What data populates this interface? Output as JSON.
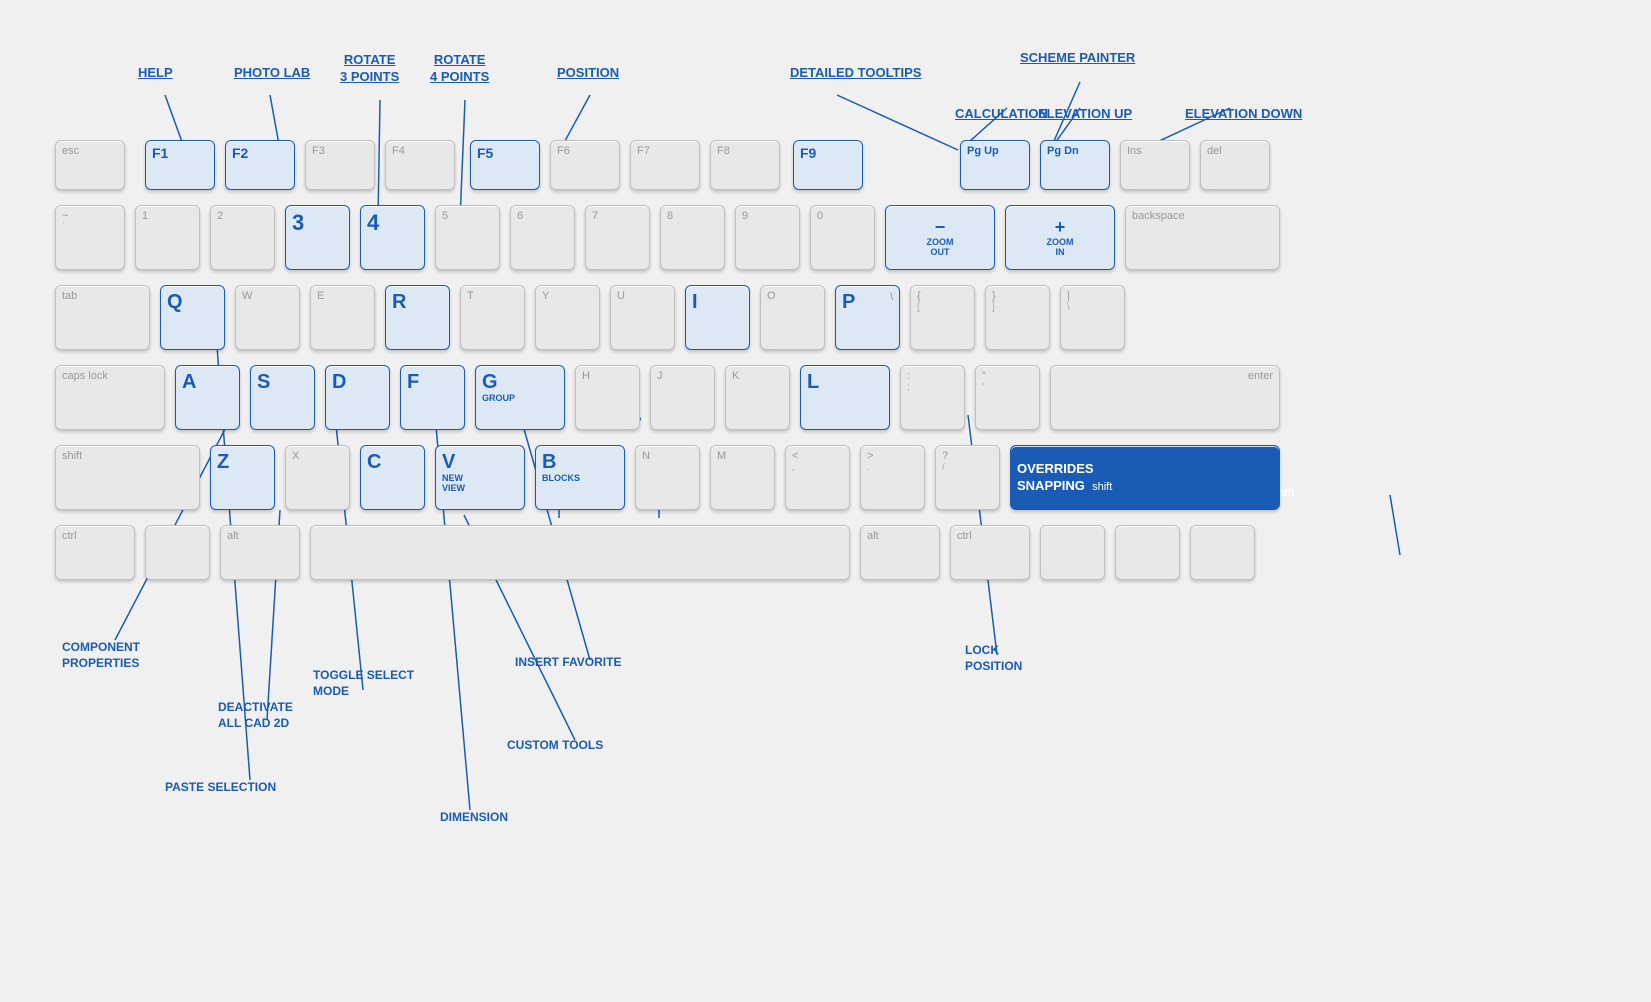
{
  "annotations": {
    "help": "HELP",
    "photo_lab": "PHOTO LAB",
    "rotate_3": "ROTATE\n3 POINTS",
    "rotate_4": "ROTATE\n4 POINTS",
    "position": "POSITION",
    "detailed_tooltips": "DETAILED TOOLTIPS",
    "scheme_painter": "SCHEME PAINTER",
    "calculation": "CALCULATION",
    "elevation_up": "ELEVATION UP",
    "elevation_down": "ELEVATION DOWN",
    "zoom_out": "ZOOM\nOUT",
    "zoom_in": "ZOOM\nIN",
    "group": "GROUP",
    "new_view": "NEW\nVIEW",
    "blocks": "BLOCKS",
    "overrides_snapping": "OVERRIDES\nSNAPPING",
    "component_properties": "COMPONENT\nPROPERTIES",
    "paste_selection": "PASTE  SELECTION",
    "deactivate_cad": "DEACTIVATE\nALL CAD 2D",
    "toggle_select": "TOGGLE  SELECT\nMODE",
    "dimension": "DIMENSION",
    "insert_favorite": "INSERT  FAVORITE",
    "custom_tools": "CUSTOM TOOLS",
    "lock_position": "LOCK\nPOSITION"
  },
  "keys": {
    "esc": "esc",
    "f1": "F1",
    "f2": "F2",
    "f3": "F3",
    "f4": "F4",
    "f5": "F5",
    "f6": "F6",
    "f7": "F7",
    "f8": "F8",
    "f9": "F9",
    "pgup": "Pg Up",
    "pgdn": "Pg Dn",
    "ins": "Ins",
    "del": "del"
  }
}
